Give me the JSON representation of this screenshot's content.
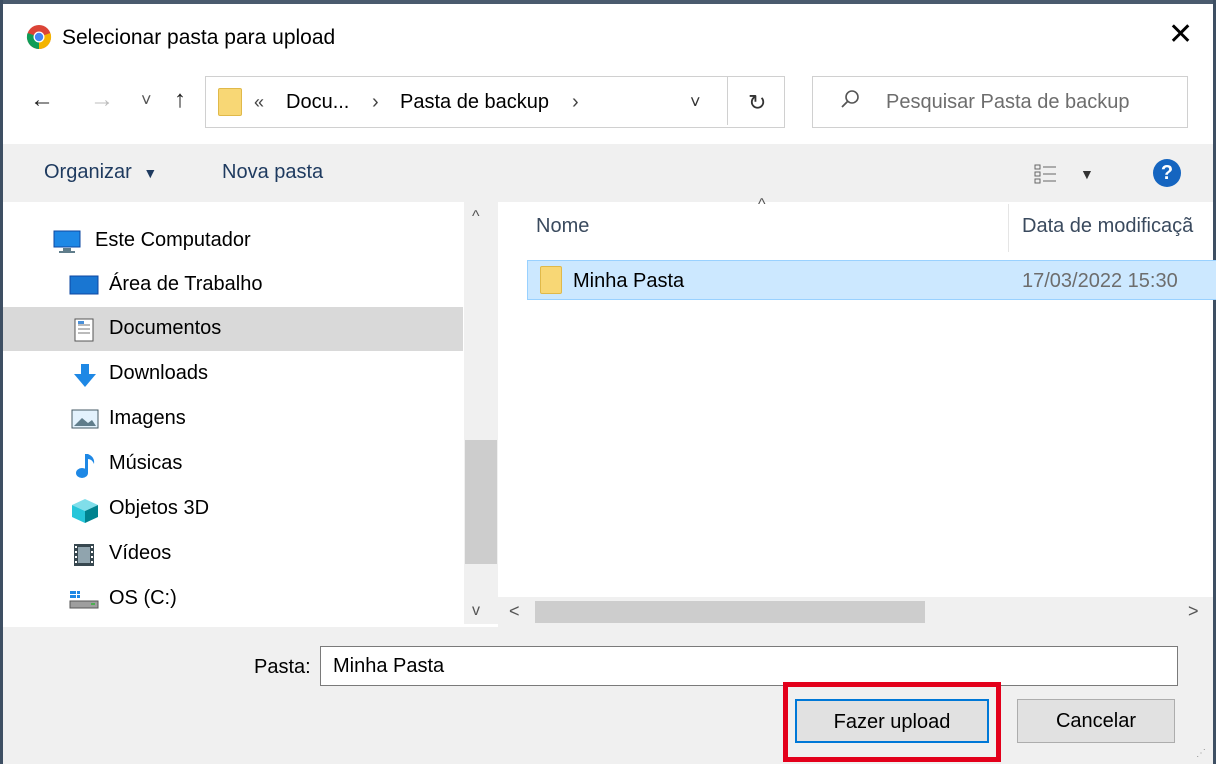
{
  "dialog": {
    "title": "Selecionar pasta para upload",
    "close_label": "✕"
  },
  "nav": {
    "back": "←",
    "forward": "→",
    "recent": "˅",
    "up": "↑",
    "breadcrumb": [
      "«",
      "Docu...",
      "›",
      "Pasta de backup",
      "›"
    ],
    "dropdown": "˅",
    "refresh": "↻",
    "search_placeholder": "Pesquisar Pasta de backup"
  },
  "toolbar": {
    "organize": "Organizar",
    "new_folder": "Nova pasta",
    "help": "?"
  },
  "sidebar": {
    "items": [
      {
        "label": "Este Computador",
        "icon": "computer-icon"
      },
      {
        "label": "Área de Trabalho",
        "icon": "desktop-icon"
      },
      {
        "label": "Documentos",
        "icon": "documents-icon",
        "selected": true
      },
      {
        "label": "Downloads",
        "icon": "downloads-icon"
      },
      {
        "label": "Imagens",
        "icon": "pictures-icon"
      },
      {
        "label": "Músicas",
        "icon": "music-icon"
      },
      {
        "label": "Objetos 3D",
        "icon": "objects3d-icon"
      },
      {
        "label": "Vídeos",
        "icon": "videos-icon"
      },
      {
        "label": "OS (C:)",
        "icon": "drive-icon"
      }
    ]
  },
  "list": {
    "columns": [
      "Nome",
      "Data de modificaçã"
    ],
    "rows": [
      {
        "name": "Minha Pasta",
        "modified": "17/03/2022 15:30"
      }
    ]
  },
  "footer": {
    "folder_label": "Pasta:",
    "folder_value": "Minha Pasta",
    "upload_button": "Fazer upload",
    "cancel_button": "Cancelar"
  },
  "colors": {
    "selection": "#cce8ff",
    "highlight_box": "#e3001b",
    "primary_border": "#0078d7"
  }
}
